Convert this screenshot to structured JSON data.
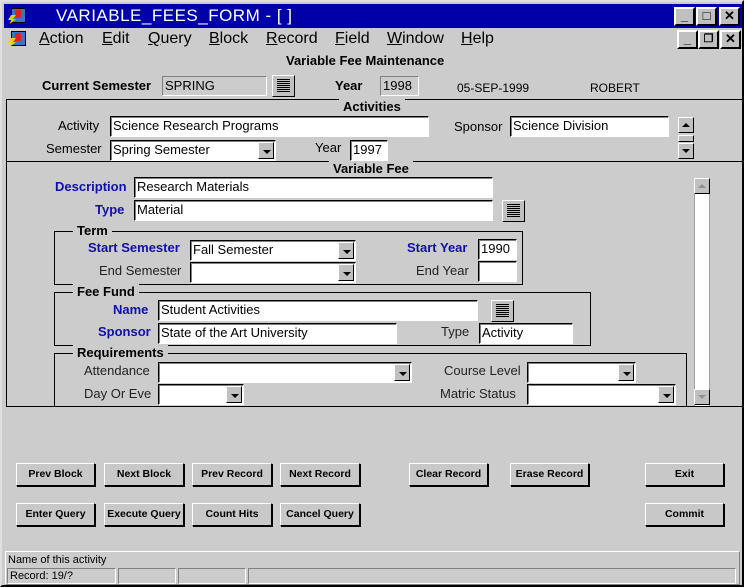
{
  "window": {
    "title": "VARIABLE_FEES_FORM - [ ]",
    "controls": {
      "minimize": "_",
      "maximize": "□",
      "close": "✕"
    },
    "mdi_controls": {
      "minimize": "_",
      "restore": "🗗",
      "close": "✕"
    }
  },
  "menu": {
    "items": [
      {
        "label": "Action",
        "accel": "A"
      },
      {
        "label": "Edit",
        "accel": "E"
      },
      {
        "label": "Query",
        "accel": "Q"
      },
      {
        "label": "Block",
        "accel": "B"
      },
      {
        "label": "Record",
        "accel": "R"
      },
      {
        "label": "Field",
        "accel": "F"
      },
      {
        "label": "Window",
        "accel": "W"
      },
      {
        "label": "Help",
        "accel": "H"
      }
    ]
  },
  "header": {
    "form_title": "Variable Fee Maintenance",
    "current_semester_label": "Current Semester",
    "current_semester_value": "SPRING",
    "year_label": "Year",
    "year_value": "1998",
    "date": "05-SEP-1999",
    "user": "ROBERT"
  },
  "activities": {
    "title": "Activities",
    "activity_label": "Activity",
    "activity_value": "Science Research Programs",
    "sponsor_label": "Sponsor",
    "sponsor_value": "Science Division",
    "semester_label": "Semester",
    "semester_value": "Spring Semester",
    "year_label": "Year",
    "year_value": "1997"
  },
  "variable_fee": {
    "title": "Variable Fee",
    "description_label": "Description",
    "description_value": "Research Materials",
    "type_label": "Type",
    "type_value": "Material",
    "term": {
      "title": "Term",
      "start_semester_label": "Start Semester",
      "start_semester_value": "Fall Semester",
      "end_semester_label": "End Semester",
      "end_semester_value": "",
      "start_year_label": "Start Year",
      "start_year_value": "1990",
      "end_year_label": "End Year",
      "end_year_value": ""
    },
    "fee_fund": {
      "title": "Fee Fund",
      "name_label": "Name",
      "name_value": "Student Activities",
      "sponsor_label": "Sponsor",
      "sponsor_value": "State of the Art University",
      "type_label": "Type",
      "type_value": "Activity"
    },
    "requirements": {
      "title": "Requirements",
      "attendance_label": "Attendance",
      "attendance_value": "",
      "day_or_eve_label": "Day Or Eve",
      "day_or_eve_value": "",
      "course_level_label": "Course Level",
      "course_level_value": "",
      "matric_status_label": "Matric Status",
      "matric_status_value": ""
    }
  },
  "buttons": {
    "prev_block": "Prev Block",
    "next_block": "Next Block",
    "prev_record": "Prev Record",
    "next_record": "Next Record",
    "clear_record": "Clear Record",
    "erase_record": "Erase Record",
    "exit": "Exit",
    "enter_query": "Enter Query",
    "execute_query": "Execute Query",
    "count_hits": "Count Hits",
    "cancel_query": "Cancel Query",
    "commit": "Commit"
  },
  "status": {
    "hint": "Name of this activity",
    "record": "Record: 19/?",
    "cell2": "",
    "cell3": "",
    "cell4": ""
  }
}
